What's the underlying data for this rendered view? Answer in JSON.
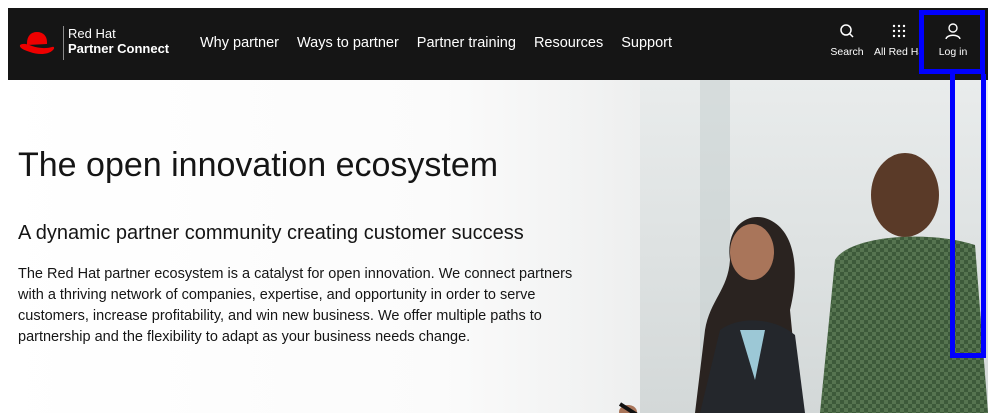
{
  "brand": {
    "line1": "Red Hat",
    "line2": "Partner Connect",
    "logo_icon": "red-hat-logo"
  },
  "nav": {
    "items": [
      "Why partner",
      "Ways to partner",
      "Partner training",
      "Resources",
      "Support"
    ]
  },
  "utilities": {
    "search": {
      "label": "Search",
      "icon": "search-icon"
    },
    "apps": {
      "label": "All Red Hat",
      "icon": "grid-icon"
    },
    "login": {
      "label": "Log in",
      "icon": "user-icon"
    }
  },
  "hero": {
    "title": "The open innovation ecosystem",
    "subtitle": "A dynamic partner community creating customer success",
    "paragraph": "The Red Hat partner ecosystem is a catalyst for open innovation. We connect partners with a thriving network of companies, expertise, and opportunity in order to serve customers, increase profitability, and win new business. We offer multiple paths to partnership and the flexibility to adapt as your business needs change."
  },
  "colors": {
    "nav_bg": "#151515",
    "brand_red": "#ee0000",
    "highlight": "#0000ff",
    "text": "#151515"
  }
}
